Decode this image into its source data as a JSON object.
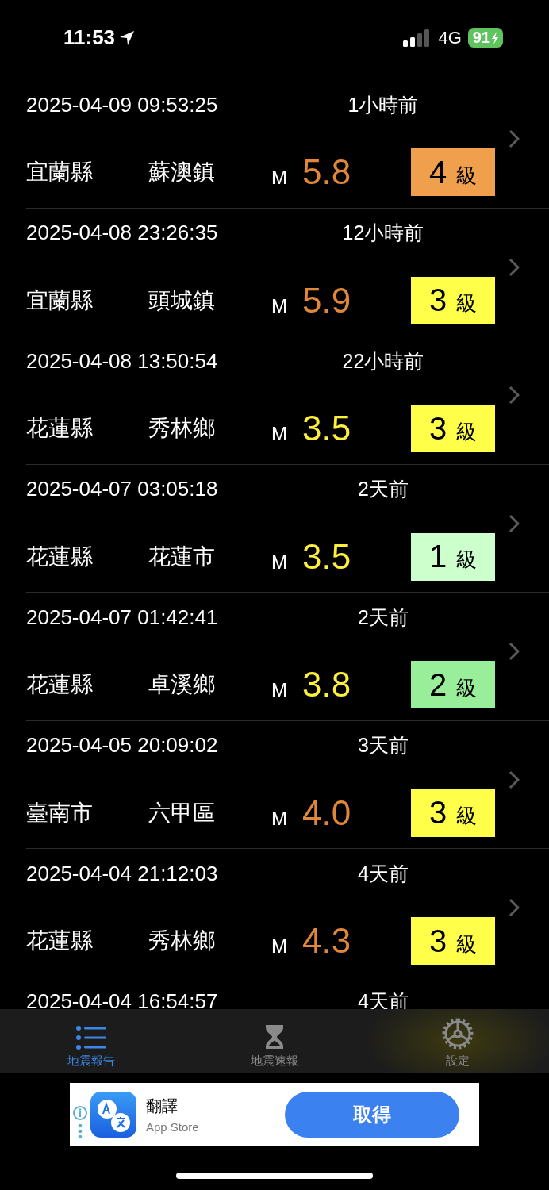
{
  "status_bar": {
    "time": "11:53",
    "network": "4G",
    "battery": "91"
  },
  "reports": [
    {
      "time": "2025-04-09 09:53:25",
      "ago": "1小時前",
      "county": "宜蘭縣",
      "town": "蘇澳鎮",
      "magnitude": {
        "prefix": "M",
        "value": "5.8",
        "color": "#e0873a"
      },
      "intensity": {
        "value": "4",
        "unit": "級",
        "color": "#f0a04c"
      }
    },
    {
      "time": "2025-04-08 23:26:35",
      "ago": "12小時前",
      "county": "宜蘭縣",
      "town": "頭城鎮",
      "magnitude": {
        "prefix": "M",
        "value": "5.9",
        "color": "#e0873a"
      },
      "intensity": {
        "value": "3",
        "unit": "級",
        "color": "#ffff4a"
      }
    },
    {
      "time": "2025-04-08 13:50:54",
      "ago": "22小時前",
      "county": "花蓮縣",
      "town": "秀林鄉",
      "magnitude": {
        "prefix": "M",
        "value": "3.5",
        "color": "#ffee3c"
      },
      "intensity": {
        "value": "3",
        "unit": "級",
        "color": "#ffff4a"
      }
    },
    {
      "time": "2025-04-07 03:05:18",
      "ago": "2天前",
      "county": "花蓮縣",
      "town": "花蓮市",
      "magnitude": {
        "prefix": "M",
        "value": "3.5",
        "color": "#ffee3c"
      },
      "intensity": {
        "value": "1",
        "unit": "級",
        "color": "#ccffcc"
      }
    },
    {
      "time": "2025-04-07 01:42:41",
      "ago": "2天前",
      "county": "花蓮縣",
      "town": "卓溪鄉",
      "magnitude": {
        "prefix": "M",
        "value": "3.8",
        "color": "#ffee3c"
      },
      "intensity": {
        "value": "2",
        "unit": "級",
        "color": "#99ee99"
      }
    },
    {
      "time": "2025-04-05 20:09:02",
      "ago": "3天前",
      "county": "臺南市",
      "town": "六甲區",
      "magnitude": {
        "prefix": "M",
        "value": "4.0",
        "color": "#e0873a"
      },
      "intensity": {
        "value": "3",
        "unit": "級",
        "color": "#ffff4a"
      }
    },
    {
      "time": "2025-04-04 21:12:03",
      "ago": "4天前",
      "county": "花蓮縣",
      "town": "秀林鄉",
      "magnitude": {
        "prefix": "M",
        "value": "4.3",
        "color": "#e0873a"
      },
      "intensity": {
        "value": "3",
        "unit": "級",
        "color": "#ffff4a"
      }
    },
    {
      "time": "2025-04-04 16:54:57",
      "ago": "4天前"
    }
  ],
  "tab_bar": [
    {
      "label": "地震報告",
      "kind": "list",
      "selected": true
    },
    {
      "label": "地震速報",
      "kind": "hourglass",
      "selected": false
    },
    {
      "label": "設定",
      "kind": "gear",
      "selected": false
    }
  ],
  "ad": {
    "title": "翻譯",
    "subtitle": "App Store",
    "button": "取得"
  }
}
